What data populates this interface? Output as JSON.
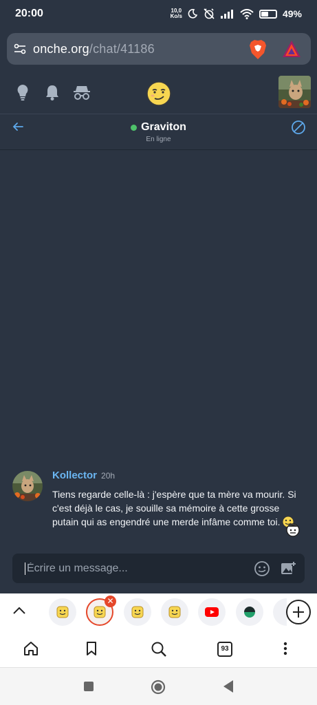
{
  "status_bar": {
    "time": "20:00",
    "net_speed_value": "10,0",
    "net_speed_unit": "Ko/s",
    "battery_percent": "49%",
    "battery_level": 0.49
  },
  "browser": {
    "url_host": "onche.org",
    "url_path": "/chat/41186",
    "tab_count": "93"
  },
  "chat": {
    "contact_name": "Graviton",
    "contact_status": "En ligne",
    "messages": [
      {
        "author": "Kollector",
        "time": "20h",
        "text": "Tiens regarde celle-là : j'espère que ta mère va mourir. Si c'est déjà le cas, je souille sa mémoire à cette grosse putain qui as engendré une merde infâme comme toi."
      }
    ],
    "composer_placeholder": "Écrire un message..."
  },
  "colors": {
    "background": "#2b3442",
    "url_box": "#4a5361",
    "author": "#6bb6f2",
    "online": "#4ec26a",
    "accent_red": "#e5472a"
  },
  "icons": {
    "header": [
      "lightbulb-icon",
      "bell-icon",
      "incognito-icon",
      "smiley-logo-icon",
      "avatar"
    ],
    "chat_header": [
      "arrow-left-icon",
      "block-icon"
    ],
    "composer": [
      "emoji-icon",
      "add-image-icon"
    ],
    "tabs": [
      "chevron-up-icon",
      "smiley-tab",
      "smiley-tab-active",
      "smiley-tab",
      "smiley-tab",
      "youtube-tab",
      "green-tab",
      "plus-icon"
    ],
    "browser_nav": [
      "home-icon",
      "bookmark-icon",
      "search-icon",
      "tab-count",
      "more-icon"
    ],
    "android_nav": [
      "recent-apps-icon",
      "home-circle-icon",
      "back-triangle-icon"
    ]
  }
}
